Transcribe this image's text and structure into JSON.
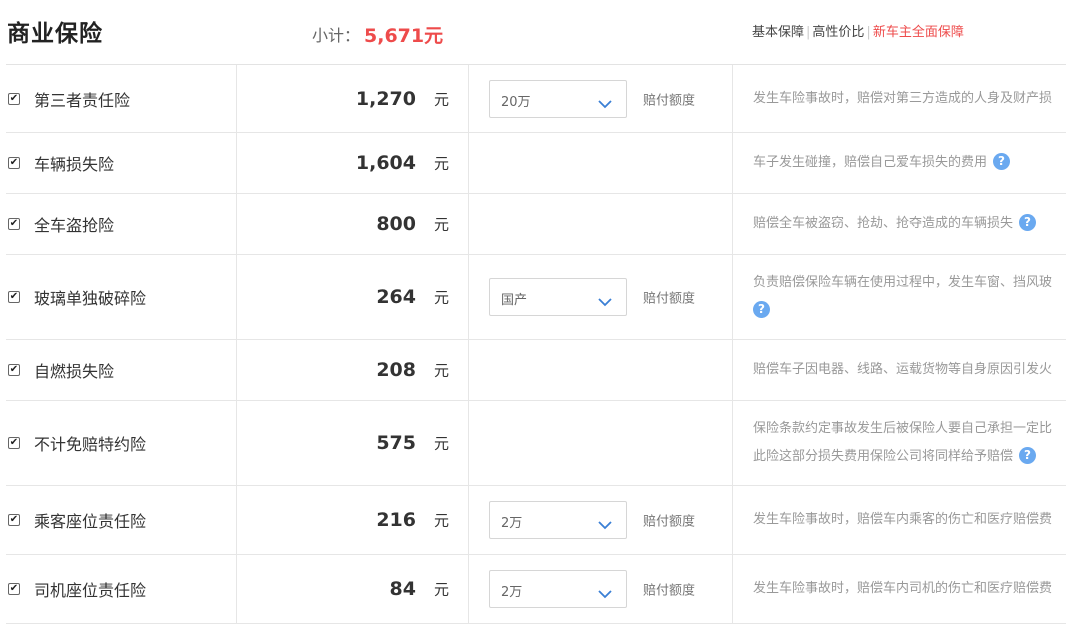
{
  "header": {
    "title": "商业保险",
    "subtotal_label": "小计：",
    "subtotal_value": "5,671元",
    "plans": [
      {
        "label": "基本保障",
        "active": false
      },
      {
        "label": "高性价比",
        "active": false
      },
      {
        "label": "新车主全面保障",
        "active": true
      }
    ]
  },
  "rows": [
    {
      "checked": true,
      "name": "第三者责任险",
      "price": "1,270",
      "unit": "元",
      "select": "20万",
      "pay_label": "赔付额度",
      "desc": [
        "发生车险事故时，赔偿对第三方造成的人身及财产损"
      ],
      "help": false
    },
    {
      "checked": true,
      "name": "车辆损失险",
      "price": "1,604",
      "unit": "元",
      "select": null,
      "pay_label": null,
      "desc": [
        "车子发生碰撞，赔偿自己爱车损失的费用"
      ],
      "help": true
    },
    {
      "checked": true,
      "name": "全车盗抢险",
      "price": "800",
      "unit": "元",
      "select": null,
      "pay_label": null,
      "desc": [
        "赔偿全车被盗窃、抢劫、抢夺造成的车辆损失"
      ],
      "help": true
    },
    {
      "checked": true,
      "name": "玻璃单独破碎险",
      "price": "264",
      "unit": "元",
      "select": "国产",
      "pay_label": "赔付额度",
      "desc": [
        "负责赔偿保险车辆在使用过程中，发生车窗、挡风玻"
      ],
      "help": true,
      "help_newline": true
    },
    {
      "checked": true,
      "name": "自燃损失险",
      "price": "208",
      "unit": "元",
      "select": null,
      "pay_label": null,
      "desc": [
        "赔偿车子因电器、线路、运载货物等自身原因引发火"
      ],
      "help": false
    },
    {
      "checked": true,
      "name": "不计免赔特约险",
      "price": "575",
      "unit": "元",
      "select": null,
      "pay_label": null,
      "desc": [
        "保险条款约定事故发生后被保险人要自己承担一定比",
        "此险这部分损失费用保险公司将同样给予赔偿"
      ],
      "help": true
    },
    {
      "checked": true,
      "name": "乘客座位责任险",
      "price": "216",
      "unit": "元",
      "select": "2万",
      "pay_label": "赔付额度",
      "desc": [
        "发生车险事故时，赔偿车内乘客的伤亡和医疗赔偿费"
      ],
      "help": false
    },
    {
      "checked": true,
      "name": "司机座位责任险",
      "price": "84",
      "unit": "元",
      "select": "2万",
      "pay_label": "赔付额度",
      "desc": [
        "发生车险事故时，赔偿车内司机的伤亡和医疗赔偿费"
      ],
      "help": false
    }
  ],
  "icons": {
    "checkbox": "checkmark-icon",
    "select_arrow": "chevron-down-icon",
    "help": "question-circle-icon"
  },
  "colors": {
    "accent": "#ee4b4b",
    "help": "#6aa9f0"
  }
}
